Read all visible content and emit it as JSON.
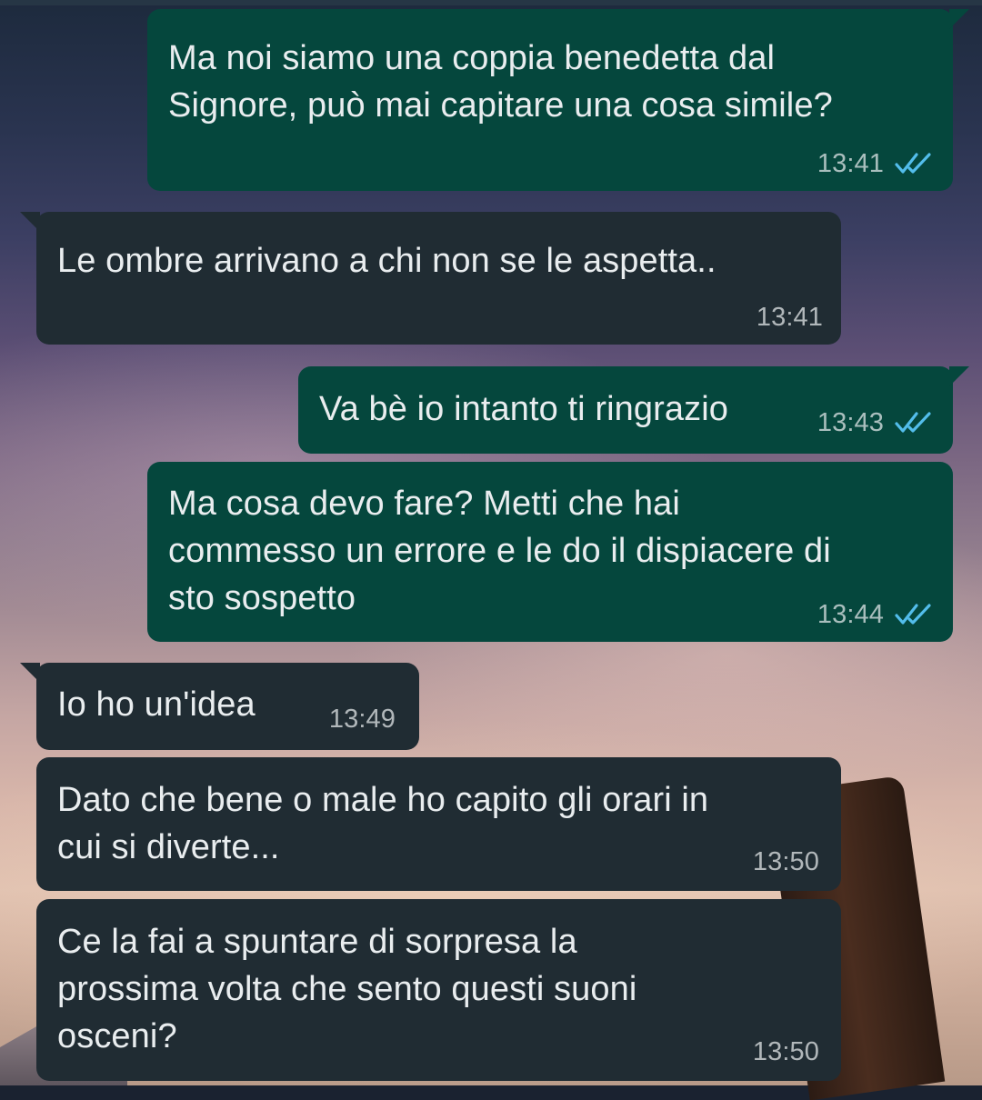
{
  "messages": [
    {
      "direction": "outgoing",
      "text": "Ma noi siamo una coppia benedetta dal\nSignore, può mai capitare una cosa simile?",
      "time": "13:41",
      "status": "read"
    },
    {
      "direction": "incoming",
      "text": "Le ombre arrivano a chi non se le aspetta..",
      "time": "13:41"
    },
    {
      "direction": "outgoing",
      "text": "Va bè io intanto ti ringrazio",
      "time": "13:43",
      "status": "read"
    },
    {
      "direction": "outgoing",
      "text": "Ma cosa devo fare? Metti che hai\ncommesso un errore e le do il dispiacere di\nsto sospetto",
      "time": "13:44",
      "status": "read"
    },
    {
      "direction": "incoming",
      "text": "Io ho un'idea",
      "time": "13:49"
    },
    {
      "direction": "incoming",
      "text": "Dato che bene o male ho capito gli orari in\ncui si diverte...",
      "time": "13:50"
    },
    {
      "direction": "incoming",
      "text": "Ce la fai a spuntare di sorpresa la\nprossima volta che sento questi suoni\nosceni?",
      "time": "13:50"
    }
  ],
  "icons": {
    "read_receipt": "double-check-icon"
  },
  "colors": {
    "outgoing_bubble": "#05473d",
    "incoming_bubble": "#202c33",
    "text": "#e9edef",
    "read_check": "#53bdeb"
  }
}
